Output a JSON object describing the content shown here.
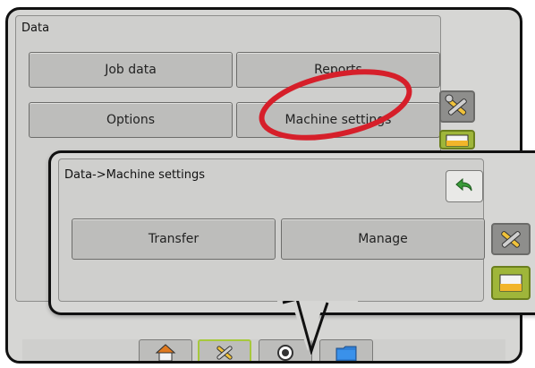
{
  "main": {
    "title": "Data",
    "buttons": {
      "job_data": "Job data",
      "reports": "Reports",
      "options": "Options",
      "machine_settings": "Machine settings"
    }
  },
  "popup": {
    "title": "Data->Machine settings",
    "buttons": {
      "transfer": "Transfer",
      "manage": "Manage"
    }
  },
  "icons": {
    "side_top": "tools-icon",
    "side_bottom": "data-storage-icon",
    "back": "back-arrow-icon",
    "tabs": [
      "home-icon",
      "tools-icon",
      "target-icon",
      "folder-icon"
    ]
  },
  "colors": {
    "accent_green": "#a7c83c",
    "highlight_red": "#d61f2a",
    "panel_gray": "#cfcfcd",
    "button_gray": "#bdbdbb"
  }
}
